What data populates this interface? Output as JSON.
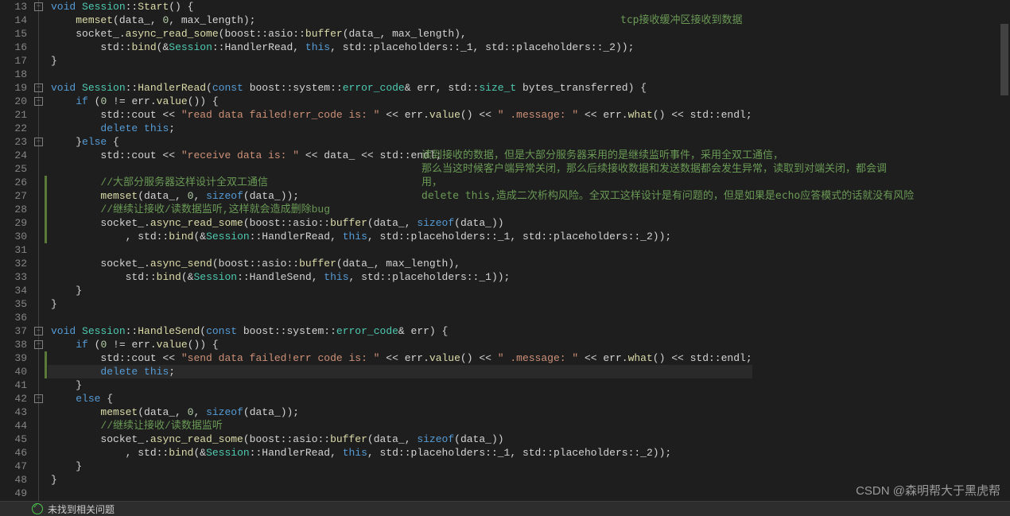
{
  "lines": {
    "start": 13,
    "end": 49,
    "highlighted": 40,
    "changed_ranges": [
      [
        26,
        30
      ],
      [
        39,
        40
      ]
    ],
    "fold_boxes": [
      13,
      19,
      20,
      23,
      37,
      38,
      42
    ]
  },
  "annotations": {
    "a1": "tcp接收缓冲区接收到数据",
    "a2": "读到接收的数据，但是大部分服务器采用的是继续监听事件，采用全双工通信，",
    "a3": "那么当这时候客户端异常关闭，那么后续接收数据和发送数据都会发生异常，读取到对端关闭，都会调",
    "a4": "用，",
    "a5": "delete this,造成二次析构风险。全双工这样设计是有问题的，但是如果是echo应答模式的话就没有风险"
  },
  "code": {
    "l13": {
      "kw1": "void",
      "cls1": "Session",
      "fn1": "Start",
      "t1": "() {"
    },
    "l14": {
      "fn1": "memset",
      "t1": "(data_, ",
      "num1": "0",
      "t2": ", max_length);"
    },
    "l15": {
      "t1": "socket_.",
      "fn1": "async_read_some",
      "t2": "(boost::asio::",
      "fn2": "buffer",
      "t3": "(data_, max_length),"
    },
    "l16": {
      "t1": "std::",
      "fn1": "bind",
      "t2": "(&",
      "cls1": "Session",
      "t3": "::HandlerRead, ",
      "kw1": "this",
      "t4": ", std::placeholders::_1, std::placeholders::_2));"
    },
    "l17": {
      "t1": "}"
    },
    "l18": {
      "t1": ""
    },
    "l19": {
      "kw1": "void",
      "cls1": "Session",
      "fn1": "HandlerRead",
      "t1": "(",
      "kw2": "const",
      "t2": " boost::system::",
      "cls2": "error_code",
      "t3": "& err, std::",
      "cls3": "size_t",
      "t4": " bytes_transferred) {"
    },
    "l20": {
      "kw1": "if",
      "t1": " (",
      "num1": "0",
      "t2": " != err.",
      "fn1": "value",
      "t3": "()) {"
    },
    "l21": {
      "t1": "std::cout << ",
      "str1": "\"read data failed!err_code is: \"",
      "t2": " << err.",
      "fn1": "value",
      "t3": "() << ",
      "str2": "\" .message: \"",
      "t4": " << err.",
      "fn2": "what",
      "t5": "() << std::endl;"
    },
    "l22": {
      "kw1": "delete",
      "t1": " ",
      "kw2": "this",
      "t2": ";"
    },
    "l23": {
      "t1": "}",
      "kw1": "else",
      "t2": " {"
    },
    "l24": {
      "t1": "std::cout << ",
      "str1": "\"receive data is: \"",
      "t2": " << data_ << std::endl;"
    },
    "l25": {
      "t1": ""
    },
    "l26": {
      "cmt1": "//大部分服务器这样设计全双工通信"
    },
    "l27": {
      "fn1": "memset",
      "t1": "(data_, ",
      "num1": "0",
      "t2": ", ",
      "kw1": "sizeof",
      "t3": "(data_));"
    },
    "l28": {
      "cmt1": "//继续让接收/读数据监听,这样就会造成删除bug"
    },
    "l29": {
      "t1": "socket_.",
      "fn1": "async_read_some",
      "t2": "(boost::asio::",
      "fn2": "buffer",
      "t3": "(data_, ",
      "kw1": "sizeof",
      "t4": "(data_))"
    },
    "l30": {
      "t1": ", std::",
      "fn1": "bind",
      "t2": "(&",
      "cls1": "Session",
      "t3": "::HandlerRead, ",
      "kw1": "this",
      "t4": ", std::placeholders::_1, std::placeholders::_2));"
    },
    "l31": {
      "t1": ""
    },
    "l32": {
      "t1": "socket_.",
      "fn1": "async_send",
      "t2": "(boost::asio::",
      "fn2": "buffer",
      "t3": "(data_, max_length),"
    },
    "l33": {
      "t1": "std::",
      "fn1": "bind",
      "t2": "(&",
      "cls1": "Session",
      "t3": "::HandleSend, ",
      "kw1": "this",
      "t4": ", std::placeholders::_1));"
    },
    "l34": {
      "t1": "}"
    },
    "l35": {
      "t1": "}"
    },
    "l36": {
      "t1": ""
    },
    "l37": {
      "kw1": "void",
      "cls1": "Session",
      "fn1": "HandleSend",
      "t1": "(",
      "kw2": "const",
      "t2": " boost::system::",
      "cls2": "error_code",
      "t3": "& err) {"
    },
    "l38": {
      "kw1": "if",
      "t1": " (",
      "num1": "0",
      "t2": " != err.",
      "fn1": "value",
      "t3": "()) {"
    },
    "l39": {
      "t1": "std::cout << ",
      "str1": "\"send data failed!err code is: \"",
      "t2": " << err.",
      "fn1": "value",
      "t3": "() << ",
      "str2": "\" .message: \"",
      "t4": " << err.",
      "fn2": "what",
      "t5": "() << std::endl;"
    },
    "l40": {
      "kw1": "delete",
      "t1": " ",
      "kw2": "this",
      "t2": ";"
    },
    "l41": {
      "t1": "}"
    },
    "l42": {
      "kw1": "else",
      "t1": " {"
    },
    "l43": {
      "fn1": "memset",
      "t1": "(data_, ",
      "num1": "0",
      "t2": ", ",
      "kw1": "sizeof",
      "t3": "(data_));"
    },
    "l44": {
      "cmt1": "//继续让接收/读数据监听"
    },
    "l45": {
      "t1": "socket_.",
      "fn1": "async_read_some",
      "t2": "(boost::asio::",
      "fn2": "buffer",
      "t3": "(data_, ",
      "kw1": "sizeof",
      "t4": "(data_))"
    },
    "l46": {
      "t1": ", std::",
      "fn1": "bind",
      "t2": "(&",
      "cls1": "Session",
      "t3": "::HandlerRead, ",
      "kw1": "this",
      "t4": ", std::placeholders::_1, std::placeholders::_2));"
    },
    "l47": {
      "t1": "}"
    },
    "l48": {
      "t1": "}"
    },
    "l49": {
      "t1": ""
    }
  },
  "indent": {
    "l13": 0,
    "l14": 1,
    "l15": 1,
    "l16": 2,
    "l17": 0,
    "l18": 0,
    "l19": 0,
    "l20": 1,
    "l21": 2,
    "l22": 2,
    "l23": 1,
    "l24": 2,
    "l25": 0,
    "l26": 2,
    "l27": 2,
    "l28": 2,
    "l29": 2,
    "l30": 3,
    "l31": 0,
    "l32": 2,
    "l33": 3,
    "l34": 1,
    "l35": 0,
    "l36": 0,
    "l37": 0,
    "l38": 1,
    "l39": 2,
    "l40": 2,
    "l41": 1,
    "l42": 1,
    "l43": 2,
    "l44": 2,
    "l45": 2,
    "l46": 3,
    "l47": 1,
    "l48": 0,
    "l49": 0
  },
  "footer": {
    "text": "未找到相关问题"
  },
  "watermark": {
    "text": "CSDN @森明帮大于黑虎帮"
  }
}
